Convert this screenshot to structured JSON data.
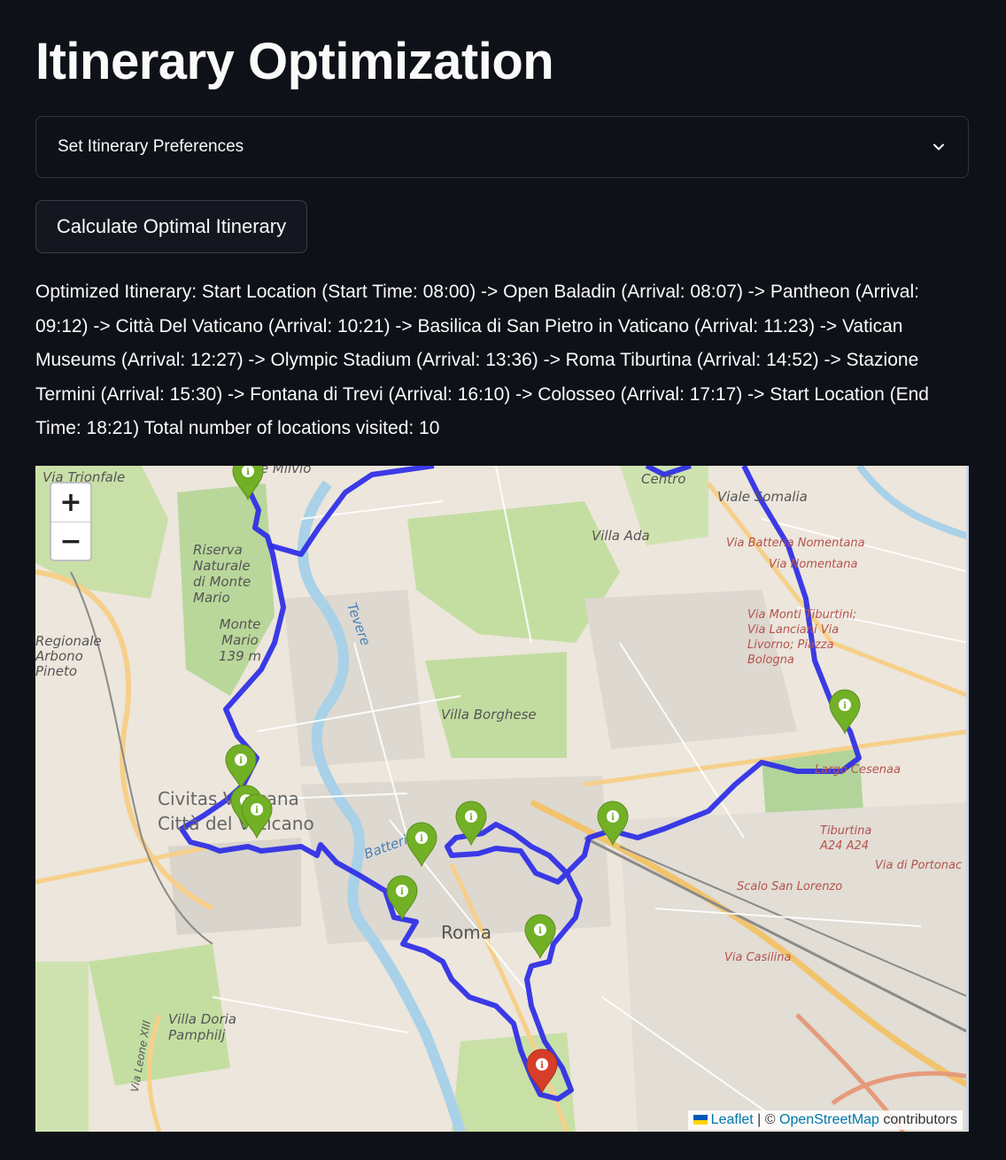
{
  "page": {
    "title": "Itinerary Optimization"
  },
  "preferences": {
    "label": "Set Itinerary Preferences",
    "icon": "chevron-down-icon"
  },
  "calculate_button": {
    "label": "Calculate Optimal Itinerary"
  },
  "itinerary_text": "Optimized Itinerary: Start Location (Start Time: 08:00) -> Open Baladin (Arrival: 08:07) -> Pantheon (Arrival: 09:12) -> Città Del Vaticano (Arrival: 10:21) -> Basilica di San Pietro in Vaticano (Arrival: 11:23) -> Vatican Museums (Arrival: 12:27) -> Olympic Stadium (Arrival: 13:36) -> Roma Tiburtina (Arrival: 14:52) -> Stazione Termini (Arrival: 15:30) -> Fontana di Trevi (Arrival: 16:10) -> Colosseo (Arrival: 17:17) -> Start Location (End Time: 18:21) Total number of locations visited: 10",
  "map": {
    "zoom_in": "+",
    "zoom_out": "−",
    "attribution": {
      "leaflet": "Leaflet",
      "separator": " | © ",
      "osm": "OpenStreetMap",
      "suffix": " contributors"
    },
    "labels": {
      "via_trionfale": "Via Trionfale",
      "ponte_milvio": "te Milvio",
      "centro": "Centro",
      "viale_somalia": "Viale Somalia",
      "riserva": "Riserva Naturale di Monte Mario",
      "monte_mario": "Monte Mario 139 m",
      "villa_ada": "Villa Ada",
      "via_batteria": "Via Batteria Nomentana",
      "via_nomentana": "Via Nomentana",
      "via_monti": "Via Monti Tiburtini; Via Lanciani Via Livorno; Piazza Bologna",
      "regionale": "Regionale Arbono Pineto",
      "villa_borghese": "Villa Borghese",
      "civita": "Civitas Vaticana Città del Vaticano",
      "tevere": "Tevere",
      "lungo_tevere": "Batteria",
      "roma": "Roma",
      "via_cesena": "Largo Cesenaa",
      "tiburtina": "Tiburtina A24 A24",
      "portonaccio": "Via di Portonac",
      "scalo": "Scalo San Lorenzo",
      "via_casilina": "Via Casilina",
      "villa_doria": "Villa Doria Pamphilj",
      "via_leone": "Via Leone XIII"
    },
    "marker_colors": {
      "visited": "#72b026",
      "start": "#d63e2a"
    },
    "route_color": "#2b2be6"
  }
}
